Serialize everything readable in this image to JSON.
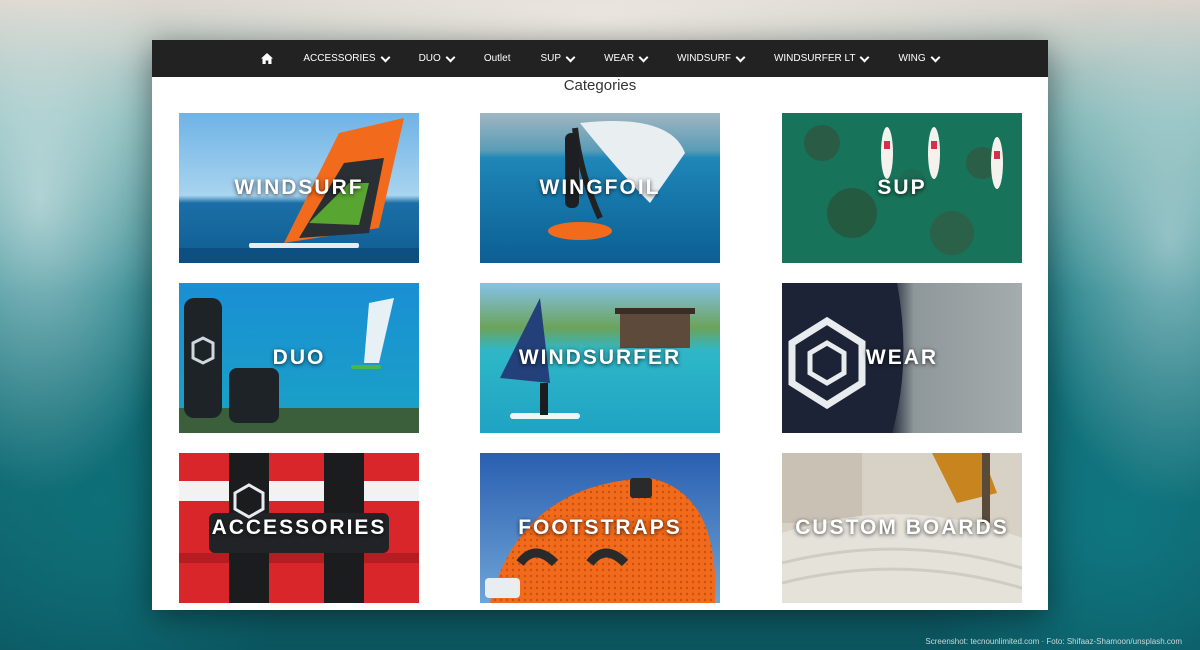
{
  "nav": {
    "items": [
      {
        "label": "",
        "icon": "home-icon",
        "dropdown": false
      },
      {
        "label": "ACCESSORIES",
        "dropdown": true
      },
      {
        "label": "DUO",
        "dropdown": true
      },
      {
        "label": "Outlet",
        "dropdown": false
      },
      {
        "label": "SUP",
        "dropdown": true
      },
      {
        "label": "WEAR",
        "dropdown": true
      },
      {
        "label": "WINDSURF",
        "dropdown": true
      },
      {
        "label": "WINDSURFER LT",
        "dropdown": true
      },
      {
        "label": "WING",
        "dropdown": true
      }
    ]
  },
  "page": {
    "title": "Categories"
  },
  "categories": [
    {
      "label": "WINDSURF"
    },
    {
      "label": "WINGFOIL"
    },
    {
      "label": "SUP"
    },
    {
      "label": "DUO"
    },
    {
      "label": "WINDSURFER"
    },
    {
      "label": "WEAR"
    },
    {
      "label": "ACCESSORIES"
    },
    {
      "label": "FOOTSTRAPS"
    },
    {
      "label": "CUSTOM BOARDS"
    }
  ],
  "credit": "Screenshot: tecnounlimited.com · Foto: Shifaaz-Shamoon/unsplash.com",
  "colors": {
    "nav_bg": "#222222",
    "page_bg": "#ffffff",
    "accent_orange": "#f26a1b"
  }
}
